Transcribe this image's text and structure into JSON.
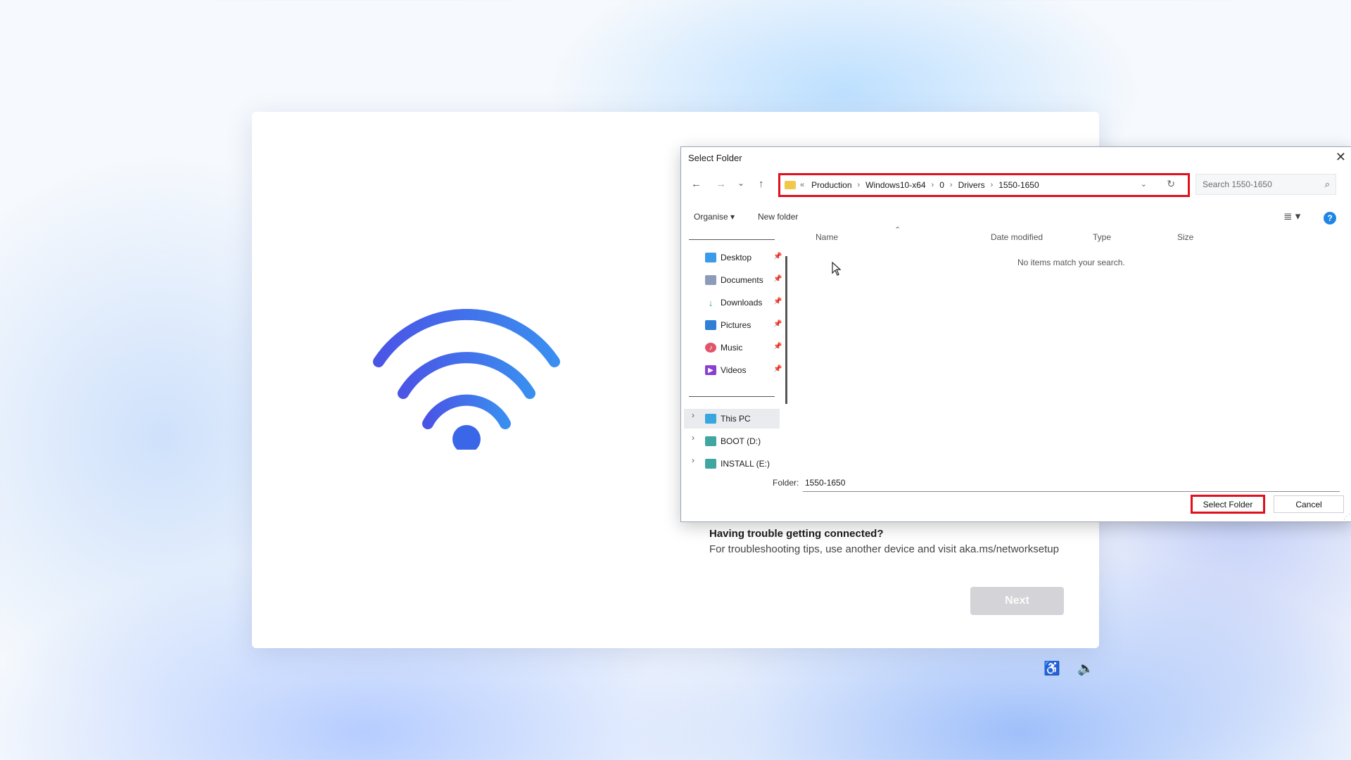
{
  "oobe": {
    "trouble_title": "Having trouble getting connected?",
    "trouble_text": "For troubleshooting tips, use another device and visit aka.ms/networksetup",
    "next_label": "Next",
    "accessibility_icon": "accessibility-icon",
    "volume_icon": "volume-icon"
  },
  "dialog": {
    "title": "Select Folder",
    "nav": {
      "back": "←",
      "forward": "→",
      "recent": "⌄",
      "up": "↑"
    },
    "address": {
      "overflow": "«",
      "crumbs": [
        "Production",
        "Windows10-x64",
        "0",
        "Drivers",
        "1550-1650"
      ],
      "separator": "›",
      "dropdown": "⌄",
      "refresh": "↻"
    },
    "search": {
      "placeholder": "Search 1550-1650",
      "icon": "⌕"
    },
    "toolbar": {
      "organise": "Organise ▾",
      "new_folder": "New folder",
      "view": "≣ ▾",
      "help": "?"
    },
    "nav_pane": {
      "quick_access": [
        {
          "label": "Desktop",
          "icon": "desktop-icon",
          "color": "#3c9be8"
        },
        {
          "label": "Documents",
          "icon": "documents-icon",
          "color": "#8c9cb8"
        },
        {
          "label": "Downloads",
          "icon": "downloads-icon",
          "color": "#2aa862"
        },
        {
          "label": "Pictures",
          "icon": "pictures-icon",
          "color": "#2f7fd6"
        },
        {
          "label": "Music",
          "icon": "music-icon",
          "color": "#e0556a"
        },
        {
          "label": "Videos",
          "icon": "videos-icon",
          "color": "#8a3fd1"
        }
      ],
      "pin": "📌",
      "drives": [
        {
          "label": "This PC",
          "icon": "this-pc-icon",
          "color": "#3aa6e0"
        },
        {
          "label": "BOOT (D:)",
          "icon": "drive-icon",
          "color": "#3fa6a0"
        },
        {
          "label": "INSTALL (E:)",
          "icon": "drive-icon",
          "color": "#3fa6a0"
        }
      ],
      "expand": "›"
    },
    "columns": {
      "name": "Name",
      "date_modified": "Date modified",
      "type": "Type",
      "size": "Size",
      "sort": "⌃"
    },
    "empty_message": "No items match your search.",
    "folder_label": "Folder:",
    "folder_value": "1550-1650",
    "select_folder_label": "Select Folder",
    "cancel_label": "Cancel",
    "close": "✕",
    "grip": "⋰"
  }
}
